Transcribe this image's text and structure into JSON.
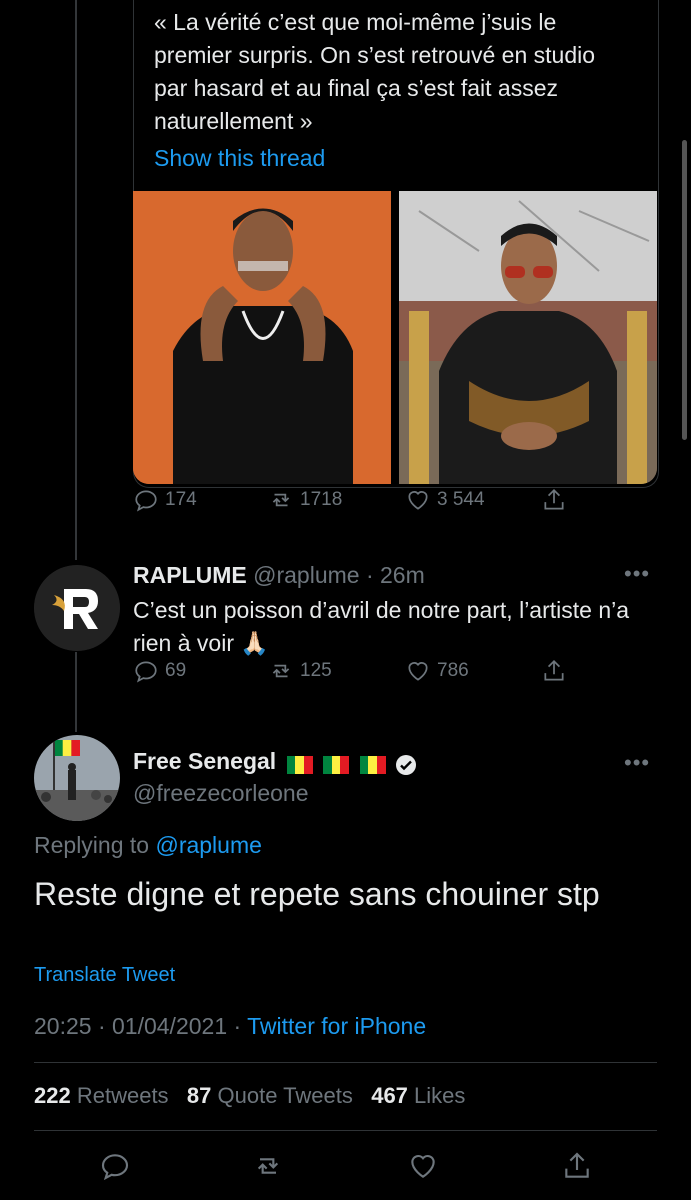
{
  "quote_tweet": {
    "text": "« La vérité c’est que moi-même j’suis le premier surpris. On s’est retrouvé en studio par hasard et au final ça s’est fait assez naturellement »",
    "show_thread": "Show this thread",
    "actions": {
      "replies": "174",
      "retweets": "1718",
      "likes": "3 544"
    }
  },
  "reply_tweet": {
    "name": "RAPLUME",
    "handle": "@raplume",
    "time": "· 26m",
    "text": "C’est un poisson d’avril de notre part, l’artiste n’a rien à voir 🙏🏻",
    "actions": {
      "replies": "69",
      "retweets": "125",
      "likes": "786"
    }
  },
  "main_tweet": {
    "name": "Free Senegal",
    "handle": "@freezecorleone",
    "replying_prefix": "Replying to",
    "replying_handle": "@raplume",
    "text": "Reste digne et repete sans chouiner stp",
    "translate": "Translate Tweet",
    "timestamp": "20:25 · 01/04/2021 ·",
    "source": "Twitter for iPhone",
    "stats": {
      "retweets_count": "222",
      "retweets_label": "Retweets",
      "quotes_count": "87",
      "quotes_label": "Quote Tweets",
      "likes_count": "467",
      "likes_label": "Likes"
    }
  },
  "icons": {
    "reply": "reply-icon",
    "retweet": "retweet-icon",
    "like": "heart-icon",
    "share": "share-icon",
    "more": "more-icon",
    "verified": "verified-icon"
  },
  "colors": {
    "link": "#1d9bf0",
    "muted": "#6e767d",
    "background": "#000000",
    "text": "#e7e9ea"
  }
}
